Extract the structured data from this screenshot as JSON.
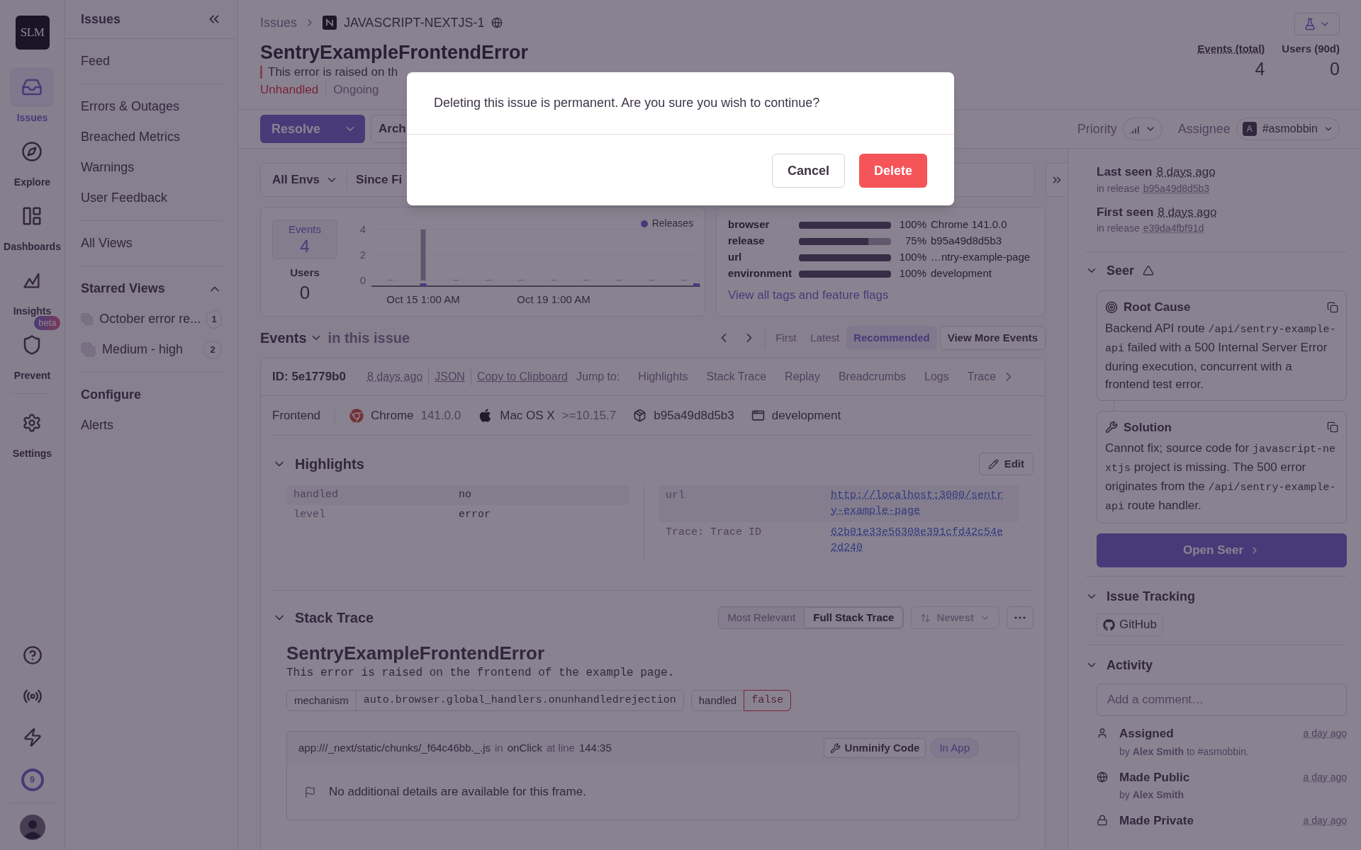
{
  "nav_rail": {
    "logo": "SLM",
    "items": [
      {
        "label": "Issues",
        "selected": true
      },
      {
        "label": "Explore",
        "selected": false
      },
      {
        "label": "Dashboards",
        "selected": false
      },
      {
        "label": "Insights",
        "selected": false
      },
      {
        "label": "Prevent",
        "selected": false,
        "badge": "beta"
      },
      {
        "label": "Settings",
        "selected": false
      }
    ],
    "usage_count": "9"
  },
  "sidebar": {
    "title": "Issues",
    "groups": [
      {
        "items": [
          {
            "label": "Feed"
          }
        ]
      },
      {
        "items": [
          {
            "label": "Errors & Outages"
          },
          {
            "label": "Breached Metrics"
          },
          {
            "label": "Warnings"
          },
          {
            "label": "User Feedback"
          }
        ]
      },
      {
        "items": [
          {
            "label": "All Views"
          }
        ]
      }
    ],
    "starred": {
      "title": "Starred Views",
      "expanded": true,
      "items": [
        {
          "label": "October error re...",
          "count": "1"
        },
        {
          "label": "Medium - high",
          "count": "2"
        }
      ]
    },
    "configure": {
      "title": "Configure",
      "items": [
        {
          "label": "Alerts"
        }
      ]
    }
  },
  "breadcrumb": [
    "Issues",
    "JAVASCRIPT-NEXTJS-1"
  ],
  "issue": {
    "title": "SentryExampleFrontendError",
    "subtitle": "This error is raised on th",
    "tags": [
      {
        "label": "Unhandled",
        "kind": "error"
      },
      {
        "label": "Ongoing",
        "kind": "plain"
      }
    ]
  },
  "stats": [
    {
      "label": "Events (total)",
      "value": "4"
    },
    {
      "label": "Users (90d)",
      "value": "0"
    }
  ],
  "actions": {
    "resolve": "Resolve",
    "archive": "Arch",
    "priority_label": "Priority",
    "assignee_label": "Assignee",
    "assignee_initial": "A",
    "assignee": "#asmobbin"
  },
  "filters": [
    "All Envs",
    "Since Fi"
  ],
  "summary": {
    "events": "4",
    "users_label": "Users",
    "users": "0",
    "releases_legend": "Releases",
    "chart_data": {
      "type": "bar",
      "categories": [
        null,
        "Oct 15 1:00 AM",
        null,
        null,
        null,
        "Oct 19 1:00 AM",
        null,
        null,
        null,
        null
      ],
      "series": [
        {
          "name": "Events",
          "color": "#a39bb0",
          "values": [
            0,
            4,
            0,
            0,
            0,
            0,
            0,
            0,
            0,
            0
          ]
        }
      ],
      "ylim": [
        0,
        4
      ],
      "yticks": [
        0,
        2,
        4
      ]
    }
  },
  "tag_distribution": {
    "rows": [
      {
        "key": "browser",
        "level": 1,
        "percent": "100%",
        "value": "Chrome 141.0.0"
      },
      {
        "key": "release",
        "level": 0.75,
        "percent": "75%",
        "value": "b95a49d8d5b3"
      },
      {
        "key": "url",
        "level": 1,
        "percent": "100%",
        "value": "…ntry-example-page"
      },
      {
        "key": "environment",
        "level": 1,
        "percent": "100%",
        "value": "development"
      }
    ],
    "link": "View all tags and feature flags"
  },
  "events_header": {
    "title": "Events",
    "suffix": "in this issue",
    "nav": [
      {
        "label": "First",
        "selected": false
      },
      {
        "label": "Latest",
        "selected": false
      },
      {
        "label": "Recommended",
        "selected": true
      }
    ],
    "more": "View More Events"
  },
  "event": {
    "id": "ID: 5e1779b0",
    "age": "8 days ago",
    "links": [
      "JSON",
      "Copy to Clipboard"
    ],
    "jump_label": "Jump to:",
    "jump": [
      "Highlights",
      "Stack Trace",
      "Replay",
      "Breadcrumbs",
      "Logs",
      "Trace"
    ],
    "context": [
      {
        "kind": "text",
        "label": "Frontend"
      },
      {
        "kind": "browser",
        "label": "Chrome",
        "version": "141.0.0"
      },
      {
        "kind": "os",
        "label": "Mac OS X",
        "version": ">=10.15.7"
      },
      {
        "kind": "release",
        "label": "b95a49d8d5b3"
      },
      {
        "kind": "environment",
        "label": "development"
      }
    ]
  },
  "highlights": {
    "title": "Highlights",
    "expanded": true,
    "edit": "Edit",
    "left": [
      {
        "key": "handled",
        "value": "no"
      },
      {
        "key": "level",
        "value": "error"
      }
    ],
    "right": [
      {
        "key": "url",
        "value": "http://localhost:3000/sentry-example-page"
      },
      {
        "key": "Trace: Trace ID",
        "value": "62b01e33e56308e391cfd42c54e2d240"
      }
    ]
  },
  "stack_trace": {
    "title": "Stack Trace",
    "expanded": true,
    "views": [
      {
        "label": "Most Relevant",
        "selected": false
      },
      {
        "label": "Full Stack Trace",
        "selected": true
      }
    ],
    "sort": "Newest",
    "exception": "SentryExampleFrontendError",
    "message": "This error is raised on the frontend of the example page.",
    "mechanism": [
      {
        "key": "mechanism",
        "value": "auto.browser.global_handlers.onunhandledrejection",
        "flagged": false
      },
      {
        "key": "handled",
        "value": "false",
        "flagged": true
      }
    ],
    "frame": {
      "file": "app:///_next/static/chunks/_f64c46bb._.js",
      "in": "in",
      "function": "onClick",
      "at": "at line",
      "line": "144:35",
      "unminify": "Unminify Code",
      "in_app": "In App",
      "note": "No additional details are available for this frame."
    }
  },
  "right_panel": {
    "seen": [
      {
        "label": "Last seen",
        "age": "8 days ago",
        "release_prefix": "in release",
        "release": "b95a49d8d5b3"
      },
      {
        "label": "First seen",
        "age": "8 days ago",
        "release_prefix": "in release",
        "release": "e39da4fbf91d"
      }
    ],
    "seer": {
      "title": "Seer",
      "expanded": true,
      "cards": [
        {
          "kind": "root_cause",
          "title": "Root Cause",
          "parts": [
            {
              "kind": "text",
              "text": "Backend API route "
            },
            {
              "kind": "code",
              "text": "/api/sentry-example-api"
            },
            {
              "kind": "text",
              "text": " failed with a 500 Internal Server Error during execution, concurrent with a frontend test error."
            }
          ]
        },
        {
          "kind": "solution",
          "title": "Solution",
          "parts": [
            {
              "kind": "text",
              "text": "Cannot fix; source code for "
            },
            {
              "kind": "code",
              "text": "javascript-nextjs"
            },
            {
              "kind": "text",
              "text": " project is missing. The 500 error originates from the "
            },
            {
              "kind": "code",
              "text": "/api/sentry-example-api"
            },
            {
              "kind": "text",
              "text": " route handler."
            }
          ]
        }
      ],
      "button": "Open Seer"
    },
    "issue_tracking": {
      "title": "Issue Tracking",
      "expanded": true,
      "items": [
        "GitHub"
      ]
    },
    "activity": {
      "title": "Activity",
      "expanded": true,
      "placeholder": "Add a comment…",
      "items": [
        {
          "kind": "assigned",
          "title": "Assigned",
          "time": "a day ago",
          "detail": "by **Alex Smith** to #asmobbin."
        },
        {
          "kind": "public",
          "title": "Made Public",
          "time": "a day ago",
          "detail": "by **Alex Smith**"
        },
        {
          "kind": "private",
          "title": "Made Private",
          "time": "a day ago"
        }
      ]
    }
  },
  "modal": {
    "message": "Deleting this issue is permanent. Are you sure you wish to continue?",
    "cancel": "Cancel",
    "confirm": "Delete"
  }
}
